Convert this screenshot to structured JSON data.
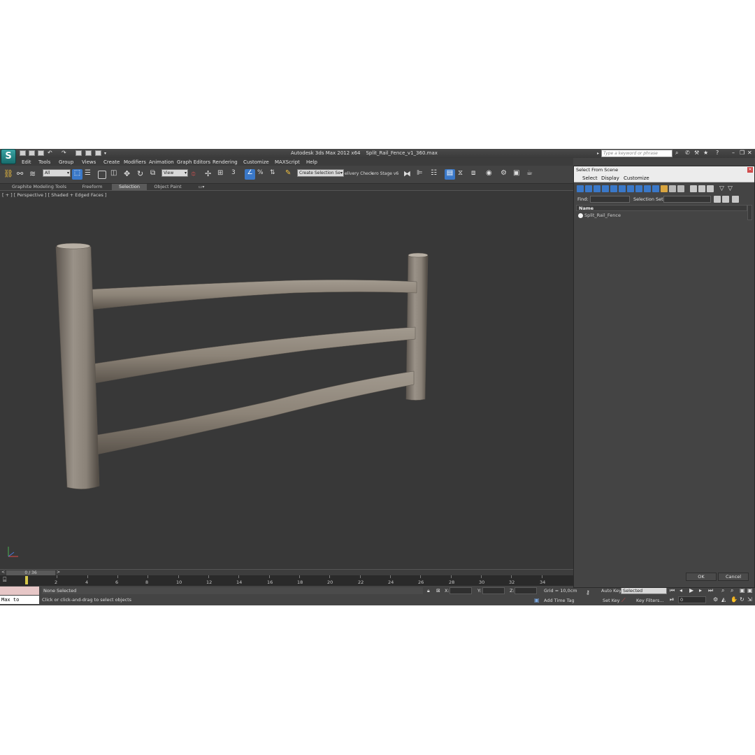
{
  "window": {
    "app_name": "Autodesk 3ds Max  2012 x64",
    "file_name": "Split_Rail_Fence_v1_360.max",
    "search_placeholder": "Type a keyword or phrase"
  },
  "menu": [
    "Edit",
    "Tools",
    "Group",
    "Views",
    "Create",
    "Modifiers",
    "Animation",
    "Graph Editors",
    "Rendering",
    "Customize",
    "MAXScript",
    "Help"
  ],
  "toolbar": {
    "filter_value": "All",
    "refcoord_value": "View",
    "selection_set_value": "Create Selection Se",
    "delivery_label": "elivery Check",
    "stage_label": "ero Stage v6"
  },
  "ribbon_tabs": [
    "Graphite Modeling Tools",
    "Freeform",
    "Selection",
    "Object Paint"
  ],
  "ribbon_active": "Selection",
  "viewport": {
    "label": "[ + ] [ Perspective ] [ Shaded + Edged Faces ]"
  },
  "timeline": {
    "slider_value": "0 / 36",
    "ticks": [
      "2",
      "4",
      "6",
      "8",
      "10",
      "12",
      "14",
      "16",
      "18",
      "20",
      "22",
      "24",
      "26",
      "28",
      "30",
      "32",
      "34"
    ]
  },
  "status": {
    "listener_text": "Max to Physc.",
    "selection_status": "None Selected",
    "prompt": "Click or click-and-drag to select objects",
    "x_label": "X:",
    "y_label": "Y:",
    "z_label": "Z:",
    "grid_text": "Grid = 10,0cm",
    "add_time_tag": "Add Time Tag",
    "auto_key": "Auto Key",
    "auto_key_value": "Selected",
    "set_key": "Set Key",
    "key_filters": "Key Filters...",
    "frame_value": "0"
  },
  "dialog": {
    "title": "Select From Scene",
    "menu": [
      "Select",
      "Display",
      "Customize"
    ],
    "find_label": "Find:",
    "selection_set_label": "Selection Set:",
    "column_header": "Name",
    "items": [
      "Split_Rail_Fence"
    ],
    "ok_label": "OK",
    "cancel_label": "Cancel"
  },
  "colors": {
    "viewport_bg": "#383838",
    "ui_bg": "#444444",
    "accent_blue": "#3a78c8",
    "timeline_marker": "#d6c84a",
    "wood": "#8d8478"
  }
}
